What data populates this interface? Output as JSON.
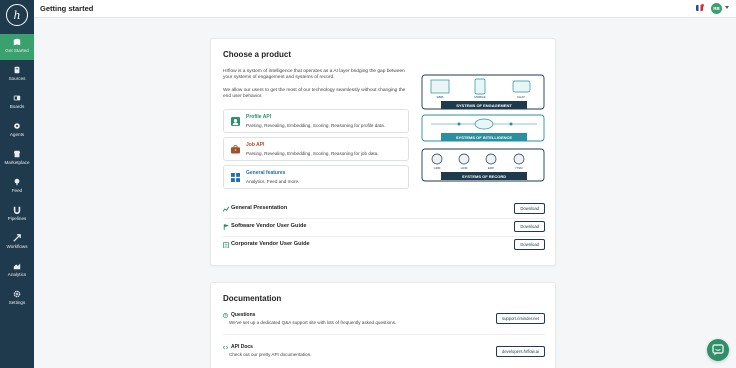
{
  "app": {
    "logo_glyph": "h"
  },
  "topbar": {
    "title": "Getting started",
    "user_initials": "RB"
  },
  "sidebar": {
    "items": [
      {
        "label": "Get Started",
        "icon": "book-icon",
        "active": true
      },
      {
        "label": "Sources",
        "icon": "sources-icon"
      },
      {
        "label": "Boards",
        "icon": "boards-icon"
      },
      {
        "label": "Agents",
        "icon": "agents-icon"
      },
      {
        "label": "Marketplace",
        "icon": "marketplace-icon"
      },
      {
        "label": "Feed",
        "icon": "feed-icon"
      },
      {
        "label": "Pipelines",
        "icon": "pipelines-icon"
      },
      {
        "label": "Workflows",
        "icon": "workflows-icon"
      },
      {
        "label": "Analytics",
        "icon": "analytics-icon"
      },
      {
        "label": "Settings",
        "icon": "gear-icon"
      }
    ]
  },
  "product": {
    "title": "Choose a product",
    "intro1": "Hrflow is a system of intelligence that operates as a AI layer bridging the gap between your systems of engagement and systems of record.",
    "intro2": "We allow our users to get the most of our technology seamlessly without changing the end user behavior.",
    "options": [
      {
        "title": "Profile API",
        "desc": "Parsing, Revealing, Embedding, Scoring, Reasoning for profile data.",
        "color": "#2f8f6b"
      },
      {
        "title": "Job API",
        "desc": "Parsing, Revealing, Embedding, Scoring, Reasoning for job data.",
        "color": "#a0522d"
      },
      {
        "title": "General features",
        "desc": "Analytics, Feed and more.",
        "color": "#1f6fb2"
      }
    ],
    "diagram": {
      "engagement": "SYSTEMS OF ENGAGEMENT",
      "intelligence": "SYSTEMS OF INTELLIGENCE",
      "record": "SYSTEMS OF RECORD",
      "top_labels": [
        "WEB",
        "MOBILE",
        "CHAT"
      ],
      "bottom_labels": [
        "CRM",
        "HCM",
        "ERP",
        "ITSM"
      ]
    },
    "downloads": [
      {
        "title": "General Presentation",
        "button": "Download"
      },
      {
        "title": "Software Vendor User Guide",
        "button": "Download"
      },
      {
        "title": "Corporate Vendor User Guide",
        "button": "Download"
      }
    ]
  },
  "documentation": {
    "title": "Documentation",
    "items": [
      {
        "title": "Questions",
        "desc": "We've set up a dedicated Q&A support site with lots of frequently asked questions.",
        "button": "support.riminder.net"
      },
      {
        "title": "API Docs",
        "desc": "Check out our pretty API documentation.",
        "button": "developers.hrflow.ai"
      }
    ]
  },
  "colors": {
    "sidebar": "#1f3a4d",
    "accent": "#3aa06e",
    "teal": "#2f8f6b"
  }
}
